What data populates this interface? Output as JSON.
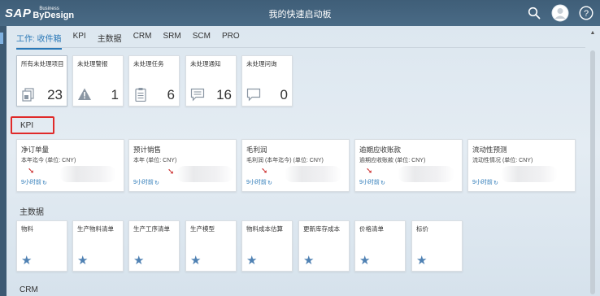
{
  "header": {
    "logo_sap": "SAP",
    "logo_business": "Business",
    "logo_bydesign": "ByDesign",
    "title": "我的快速启动板"
  },
  "tabs": [
    {
      "label": "工作: 收件箱",
      "active": true
    },
    {
      "label": "KPI",
      "active": false
    },
    {
      "label": "主数据",
      "active": false
    },
    {
      "label": "CRM",
      "active": false
    },
    {
      "label": "SRM",
      "active": false
    },
    {
      "label": "SCM",
      "active": false
    },
    {
      "label": "PRO",
      "active": false
    }
  ],
  "inbox": [
    {
      "title": "所有未处理项目",
      "count": "23",
      "icon": "document-stack-icon"
    },
    {
      "title": "未处理警报",
      "count": "1",
      "icon": "warning-icon"
    },
    {
      "title": "未处理任务",
      "count": "6",
      "icon": "clipboard-task-icon"
    },
    {
      "title": "未处理通知",
      "count": "16",
      "icon": "message-icon"
    },
    {
      "title": "未处理问询",
      "count": "0",
      "icon": "chat-bubble-icon"
    }
  ],
  "sections": {
    "kpi": "KPI",
    "master_data": "主数据",
    "crm": "CRM"
  },
  "kpis": [
    {
      "title": "净订单量",
      "subtitle": "本年迄今 (单位: CNY)",
      "time": "9小时前"
    },
    {
      "title": "预计销售",
      "subtitle": "本年 (单位: CNY)",
      "time": "9小时前"
    },
    {
      "title": "毛利润",
      "subtitle": "毛利润 (本年迄今) (单位: CNY)",
      "time": "9小时前"
    },
    {
      "title": "逾期应收账款",
      "subtitle": "逾期应收账款 (单位: CNY)",
      "time": "9小时前"
    },
    {
      "title": "流动性预测",
      "subtitle": "流动性情况 (单位: CNY)",
      "time": "9小时前"
    }
  ],
  "master_data": [
    {
      "title": "物料"
    },
    {
      "title": "生产物料清单"
    },
    {
      "title": "生产工序清单"
    },
    {
      "title": "生产模型"
    },
    {
      "title": "物料成本估算"
    },
    {
      "title": "更新库存成本"
    },
    {
      "title": "价格清单"
    },
    {
      "title": "标价"
    }
  ],
  "colors": {
    "shell": "#44637e",
    "accent": "#2a78b7",
    "trend_down": "#c81e1e",
    "highlight": "#e02a2a",
    "star": "#4f81b3"
  }
}
